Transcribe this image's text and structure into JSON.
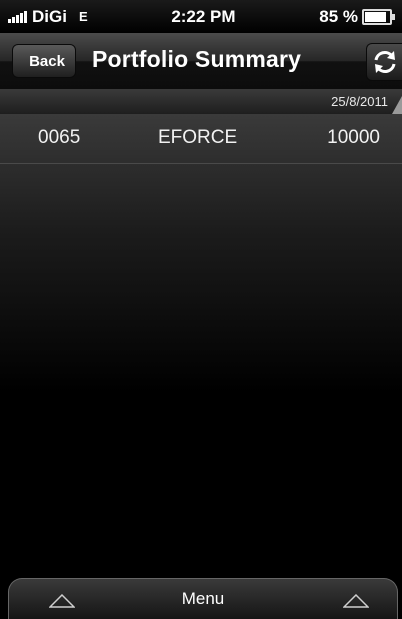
{
  "status_bar": {
    "carrier": "DiGi",
    "network": "E",
    "time": "2:22 PM",
    "battery": "85 %",
    "battery_level": 0.85
  },
  "nav": {
    "back_label": "Back",
    "title": "Portfolio Summary",
    "refresh_icon": "refresh-icon"
  },
  "date_row": {
    "date": "25/8/2011"
  },
  "portfolio": {
    "rows": [
      {
        "code": "0065",
        "name": "EFORCE",
        "quantity": "10000"
      }
    ]
  },
  "menu": {
    "label": "Menu"
  },
  "colors": {
    "background": "#000000",
    "nav_bar": "#262626",
    "row_divider": "#4a4a4a"
  }
}
